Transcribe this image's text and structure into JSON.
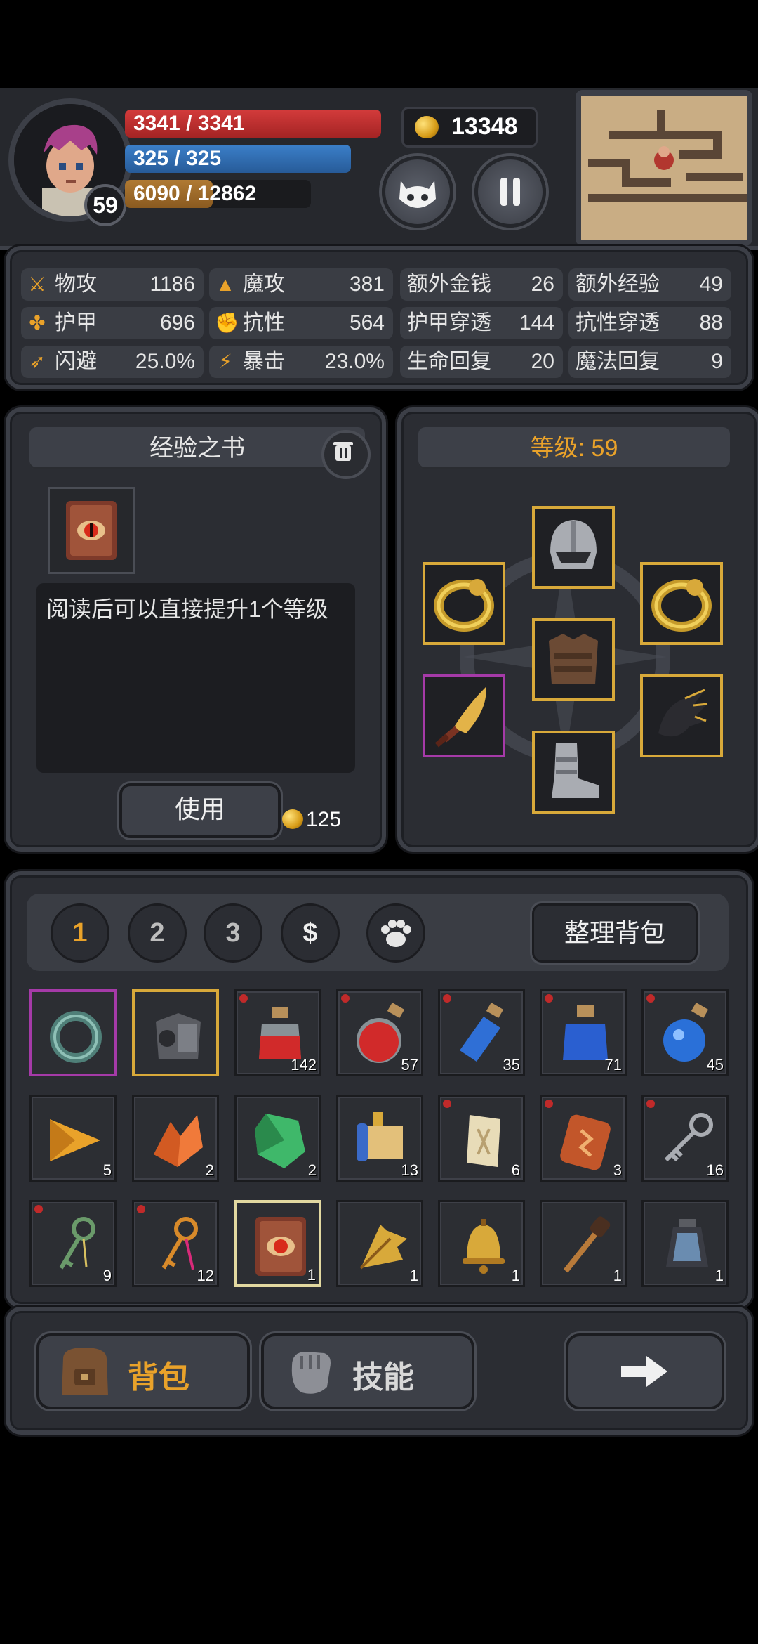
{
  "player": {
    "level": "59",
    "hp": "3341 / 3341",
    "mp": "325 / 325",
    "xp": "6090 / 12862",
    "xp_fraction": 0.47,
    "gold": "13348"
  },
  "stats": [
    {
      "label": "物攻",
      "value": "1186",
      "icon": "sword-icon"
    },
    {
      "label": "魔攻",
      "value": "381",
      "icon": "wizard-hat-icon"
    },
    {
      "label": "额外金钱",
      "value": "26"
    },
    {
      "label": "额外经验",
      "value": "49"
    },
    {
      "label": "护甲",
      "value": "696",
      "icon": "paw-icon"
    },
    {
      "label": "抗性",
      "value": "564",
      "icon": "muscle-icon"
    },
    {
      "label": "护甲穿透",
      "value": "144"
    },
    {
      "label": "抗性穿透",
      "value": "88"
    },
    {
      "label": "闪避",
      "value": "25.0%",
      "icon": "running-icon"
    },
    {
      "label": "暴击",
      "value": "23.0%",
      "icon": "lightning-icon"
    },
    {
      "label": "生命回复",
      "value": "20"
    },
    {
      "label": "魔法回复",
      "value": "9"
    }
  ],
  "item_detail": {
    "name": "经验之书",
    "description": "阅读后可以直接提升1个等级",
    "use_label": "使用",
    "price": "125"
  },
  "equipment": {
    "level_label": "等级: 59"
  },
  "inventory": {
    "tabs": [
      "1",
      "2",
      "3",
      "$"
    ],
    "sort_label": "整理背包",
    "items": [
      {
        "name": "ring",
        "count": ""
      },
      {
        "name": "armor-piece",
        "count": ""
      },
      {
        "name": "small-red-potion",
        "count": "142"
      },
      {
        "name": "red-potion",
        "count": "57"
      },
      {
        "name": "small-blue-potion",
        "count": "35"
      },
      {
        "name": "blue-potion",
        "count": "71"
      },
      {
        "name": "round-blue-potion",
        "count": "45"
      },
      {
        "name": "amber-gem",
        "count": "5"
      },
      {
        "name": "orange-crystal",
        "count": "2"
      },
      {
        "name": "green-gem",
        "count": "2"
      },
      {
        "name": "scroll",
        "count": "13"
      },
      {
        "name": "parchment",
        "count": "6"
      },
      {
        "name": "rune-stone",
        "count": "3"
      },
      {
        "name": "silver-key",
        "count": "16"
      },
      {
        "name": "green-key",
        "count": "9"
      },
      {
        "name": "orange-key",
        "count": "12"
      },
      {
        "name": "experience-book",
        "count": "1"
      },
      {
        "name": "feather-fan",
        "count": "1"
      },
      {
        "name": "bell",
        "count": "1"
      },
      {
        "name": "torch",
        "count": "1"
      },
      {
        "name": "lantern",
        "count": "1"
      }
    ]
  },
  "nav": {
    "bag_label": "背包",
    "skills_label": "技能"
  },
  "colors": {
    "accent": "#e9a22a",
    "hp": "#c83232",
    "mp": "#3372bb",
    "epic_border": "#a53aa8",
    "legendary_border": "#d8a93a"
  }
}
